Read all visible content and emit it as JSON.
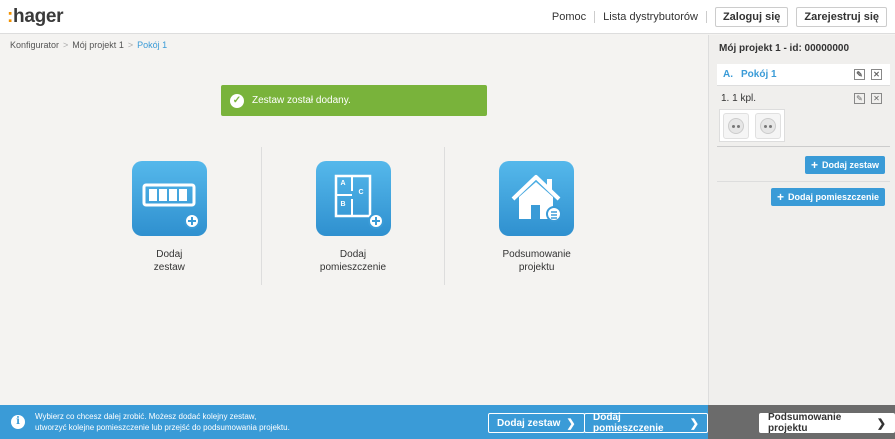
{
  "header": {
    "logo_colon": ":",
    "logo_text": "hager",
    "links": [
      "Pomoc",
      "Lista dystrybutorów"
    ],
    "login_label": "Zaloguj się",
    "register_label": "Zarejestruj się"
  },
  "breadcrumb": [
    "Konfigurator",
    "Mój projekt 1",
    "Pokój 1"
  ],
  "alert": {
    "text": "Zestaw został dodany."
  },
  "tiles": [
    {
      "line1": "Dodaj",
      "line2": "zestaw"
    },
    {
      "line1": "Dodaj",
      "line2": "pomieszczenie"
    },
    {
      "line1": "Podsumowanie",
      "line2": "projektu"
    }
  ],
  "room_plan_letters": [
    "A",
    "B",
    "C"
  ],
  "sidebar": {
    "title": "Mój projekt 1 - id: 00000000",
    "room_index": "A.",
    "room_name": "Pokój 1",
    "set_label": "1.  1 kpl.",
    "add_set_label": "Dodaj zestaw",
    "add_room_label": "Dodaj pomieszczenie"
  },
  "footer": {
    "info_line1": "Wybierz co chcesz dalej zrobić. Możesz dodać kolejny zestaw,",
    "info_line2": "utworzyć kolejne pomieszczenie lub przejść do podsumowania projektu.",
    "btn_add_set": "Dodaj zestaw",
    "btn_add_room": "Dodaj pomieszczenie",
    "btn_summary": "Podsumowanie projektu"
  },
  "colors": {
    "accent": "#3a9bd7",
    "success": "#79b33b",
    "brand_orange": "#f39200"
  }
}
